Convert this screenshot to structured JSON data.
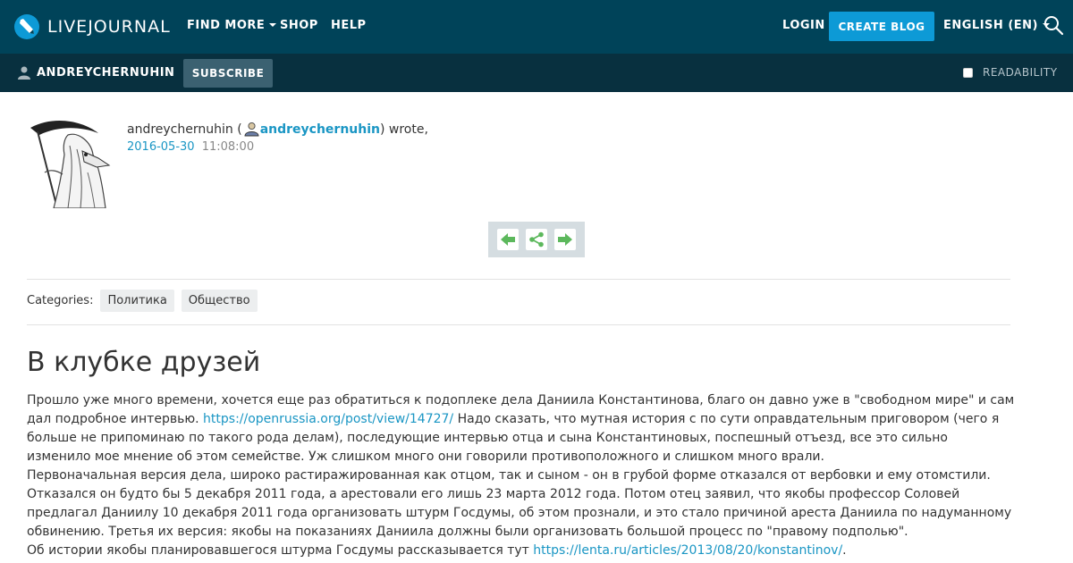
{
  "header": {
    "logo_text": "LIVEJOURNAL",
    "nav": {
      "find_more": "FIND MORE",
      "shop": "SHOP",
      "help": "HELP",
      "login": "LOGIN",
      "create_blog": "CREATE BLOG",
      "language": "ENGLISH (EN)"
    }
  },
  "subbar": {
    "username": "ANDREYCHERNUHIN",
    "subscribe": "SUBSCRIBE",
    "readability": "READABILITY"
  },
  "entry": {
    "author_name": "andreychernuhin",
    "author_open": " (",
    "author_nick": "andreychernuhin",
    "author_close": ") wrote,",
    "date": "2016-05-30",
    "time": "11:08:00",
    "categories_label": "Categories:",
    "categories": [
      "Политика",
      "Общество"
    ],
    "title": "В клубке друзей",
    "body": {
      "p1_text1": "Прошло уже много времени, хочется еще раз обратиться к подоплеке дела Даниила Константинова, благо он давно уже в \"свободном мире\" и сам дал подробное интервью. ",
      "p1_link": "https://openrussia.org/post/view/14727/",
      "p1_text2": " Надо сказать, что мутная история с по сути оправдательным приговором (чего я больше не припоминаю по такого рода делам), последующие интервью отца и сына Константиновых, поспешный отъезд, все это сильно изменило мое мнение об этом семействе. Уж слишком много они говорили противоположного и слишком много врали.",
      "p2": "Первоначальная версия дела, широко растиражированная как отцом, так и сыном - он в грубой форме отказался от вербовки и ему отомстили. Отказался он будто бы 5 декабря 2011 года, а арестовали его лишь 23 марта 2012 года. Потом отец заявил, что якобы профессор Соловей предлагал Даниилу 10 декабря 2011 года организовать штурм Госдумы, об этом прознали, и это стало причиной ареста Даниила по надуманному обвинению. Третья их версия: якобы на показаниях Даниила должны были организовать большой процесс по \"правому подполью\".",
      "p3_text1": "Об истории якобы планировавшегося штурма Госдумы рассказывается тут ",
      "p3_link": "https://lenta.ru/articles/2013/08/20/konstantinov/",
      "p3_text2": "."
    }
  },
  "colors": {
    "topbar": "#004359",
    "subbar": "#08303f",
    "accent": "#0d9ad6",
    "link": "#1a96c4",
    "arrow_green": "#5cb85c"
  }
}
